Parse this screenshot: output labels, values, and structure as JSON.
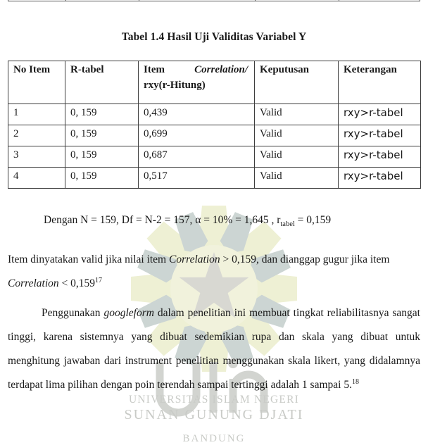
{
  "document": {
    "table_caption": "Tabel 1.4 Hasil Uji Validitas Variabel Y",
    "table": {
      "headers": {
        "no_item": "No Item",
        "r_tabel": "R-tabel",
        "correlation_word1": "Item",
        "correlation_word2": "Correlation/",
        "correlation_line2": "rxy(r-Hitung)",
        "keputusan": "Keputusan",
        "keterangan": "Keterangan"
      },
      "rows": [
        {
          "no": "1",
          "r_tabel": "0, 159",
          "correlation": "0,439",
          "keputusan": "Valid",
          "keterangan": "rxy>r-tabel"
        },
        {
          "no": "2",
          "r_tabel": "0, 159",
          "correlation": "0,699",
          "keputusan": "Valid",
          "keterangan": "rxy>r-tabel"
        },
        {
          "no": "3",
          "r_tabel": "0, 159",
          "correlation": "0,687",
          "keputusan": "Valid",
          "keterangan": "rxy>r-tabel"
        },
        {
          "no": "4",
          "r_tabel": "0, 159",
          "correlation": "0,517",
          "keputusan": "Valid",
          "keterangan": "rxy>r-tabel"
        }
      ]
    },
    "paragraphs": {
      "dengan_prefix": "Dengan N = 159, Df = N-2 = 157, α = 10% = 1,645 , r",
      "dengan_sub": "tabel",
      "dengan_suffix": " = 0,159",
      "item_valid_part1": "Item dinyatakan valid jika nilai item ",
      "item_valid_italic1": "Correlation",
      "item_valid_part2": " > 0,159, dan dianggap gugur jika item ",
      "item_valid_italic2": "Correlation",
      "item_valid_part3": " < 0,159",
      "item_valid_footnote": "17",
      "penggunakan_part1": "Penggunakan ",
      "penggunakan_italic": "googleform",
      "penggunakan_part2": " dalam penelitian ini membuat tingkat reliabilitasnya sangat tinggi, karena sistemnya yang dibuat sedemikian rupa dan skala yang dibuat untuk menghitung jawaban dari instrument penelitian menggunakan skala likert, yang didalamnya terdapat lima pilihan dengan poin terendah sampai tertinggi adalah 1 sampai 5.",
      "penggunakan_footnote": "18"
    }
  },
  "watermark": {
    "line1": "UNIVERSITAS ISLAM NEGERI",
    "line2": "SUNAN GUNUNG DJATI",
    "line3": "BANDUNG",
    "petal_color": "#eef0d4",
    "star_color": "#d8d8d2",
    "leaf_color": "#ccd5d3",
    "text_color": "#c9cbc7"
  }
}
